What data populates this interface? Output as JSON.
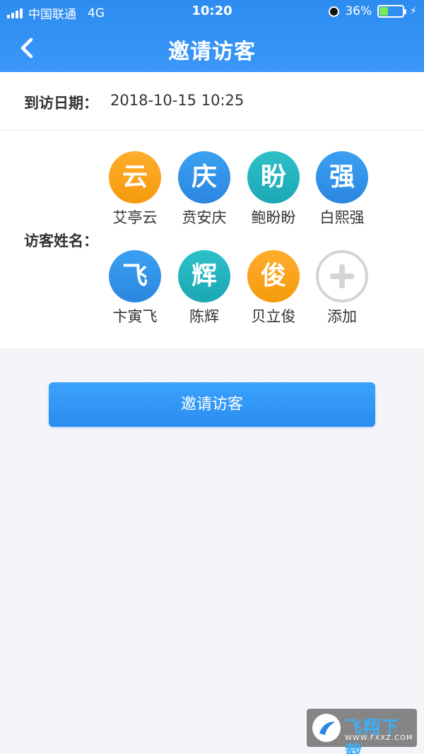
{
  "status_bar": {
    "carrier": "中国联通",
    "network": "4G",
    "time": "10:20",
    "battery_percent": "36%",
    "battery_level": 0.36
  },
  "header": {
    "title": "邀请访客"
  },
  "visit_date": {
    "label": "到访日期：",
    "value": "2018-10-15 10:25"
  },
  "visitors": {
    "label": "访客姓名：",
    "items": [
      {
        "char": "云",
        "name": "艾亭云",
        "color": "#f7a21a"
      },
      {
        "char": "庆",
        "name": "贲安庆",
        "color": "#3394ea"
      },
      {
        "char": "盼",
        "name": "鲍盼盼",
        "color": "#22b4bf"
      },
      {
        "char": "强",
        "name": "白熙强",
        "color": "#3394ea"
      },
      {
        "char": "飞",
        "name": "卞寅飞",
        "color": "#3394ea"
      },
      {
        "char": "辉",
        "name": "陈辉",
        "color": "#22b4bf"
      },
      {
        "char": "俊",
        "name": "贝立俊",
        "color": "#f7a21a"
      }
    ],
    "add_label": "添加"
  },
  "invite_button": {
    "label": "邀请访客"
  },
  "watermark": {
    "logo_char": "飞",
    "text": "飞翔下载",
    "url": "WWW.FXXZ.COM"
  }
}
